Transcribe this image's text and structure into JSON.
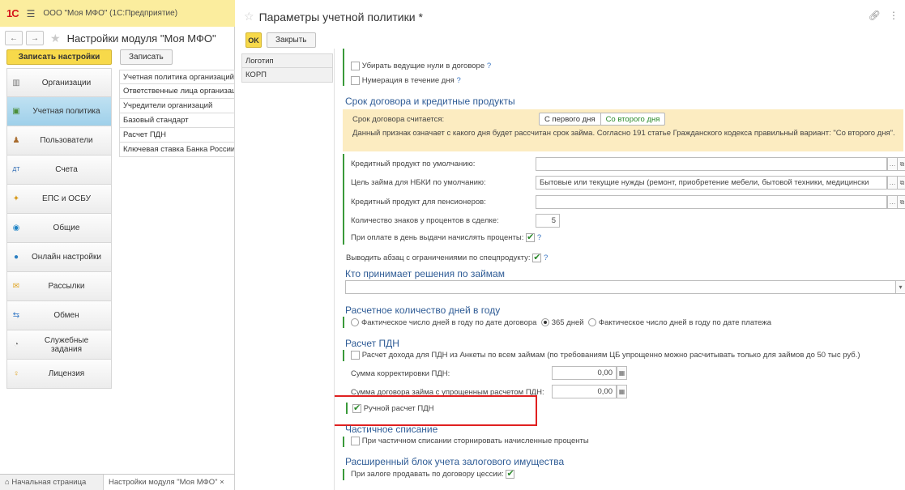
{
  "app": {
    "logo": "1С",
    "title": "ООО \"Моя МФО\"  (1С:Предприятие)"
  },
  "module": {
    "title": "Настройки модуля \"Моя МФО\"",
    "save_settings": "Записать настройки",
    "save": "Записать",
    "sections": [
      {
        "label": "Организации",
        "icon": "building-icon"
      },
      {
        "label": "Учетная политика",
        "icon": "policy-icon"
      },
      {
        "label": "Пользователи",
        "icon": "user-icon"
      },
      {
        "label": "Счета",
        "icon": "accounts-icon"
      },
      {
        "label": "ЕПС и ОСБУ",
        "icon": "eps-icon"
      },
      {
        "label": "Общие",
        "icon": "general-icon"
      },
      {
        "label": "Онлайн настройки",
        "icon": "online-icon"
      },
      {
        "label": "Рассылки",
        "icon": "mail-icon"
      },
      {
        "label": "Обмен",
        "icon": "exchange-icon"
      },
      {
        "label": "Служебные задания",
        "icon": "jobs-icon"
      },
      {
        "label": "Лицензия",
        "icon": "license-icon"
      }
    ],
    "subnav": [
      "Учетная политика организаций",
      "Ответственные лица организаций",
      "Учредители организаций",
      "Базовый стандарт",
      "Расчет ПДН",
      "Ключевая ставка Банка России"
    ],
    "bottom_tabs": [
      "Начальная страница",
      "Настройки модуля \"Моя МФО\""
    ],
    "tab_close": "×"
  },
  "form": {
    "title": "Параметры учетной политики *",
    "ok": "OK",
    "close": "Закрыть",
    "tabs": [
      "Логотип",
      "КОРП"
    ],
    "opt_remove_zeros": "Убирать ведущие нули в договоре",
    "opt_day_numbering": "Нумерация в течение дня",
    "help_mark": "?",
    "section_term": "Срок договора и кредитные продукты",
    "term_label": "Срок договора считается:",
    "term_first": "С первого дня",
    "term_second": "Со второго дня",
    "term_note": "Данный признак означает с какого дня будет рассчитан срок займа. Согласно 191 статье Гражданского кодекса правильный вариант: \"Со второго дня\".",
    "credit_product_label": "Кредитный продукт по умолчанию:",
    "credit_product_value": "",
    "nbki_label": "Цель займа для НБКИ по умолчанию:",
    "nbki_value": "Бытовые или текущие нужды (ремонт, приобретение мебели, бытовой техники, медицински",
    "pension_label": "Кредитный продукт для пенсионеров:",
    "pension_value": "",
    "decimals_label": "Количество знаков у процентов в сделке:",
    "decimals_value": "5",
    "accrue_label": "При оплате в день выдачи начислять проценты:",
    "paragraph_label": "Выводить абзац с ограничениями по спецпродукту:",
    "section_decisions": "Кто принимает решения по займам",
    "decisions_value": "",
    "section_days": "Расчетное количество дней в году",
    "days_opt1": "Фактическое число дней в году по дате договора",
    "days_opt2": "365 дней",
    "days_opt3": "Фактическое число дней в году по дате платежа",
    "section_pdn": "Расчет ПДН",
    "pdn_income": "Расчет дохода для ПДН из Анкеты по всем займам (по требованиям ЦБ упрощенно можно расчитывать только для займов до 50 тыс руб.)",
    "pdn_correction_label": "Сумма корректировки ПДН:",
    "pdn_correction_value": "0,00",
    "pdn_simplified_label": "Сумма договора займа с упрощенным расчетом ПДН:",
    "pdn_simplified_value": "0,00",
    "pdn_manual": "Ручной расчет ПДН",
    "section_partial": "Частичное списание",
    "partial_opt": "При частичном списании сторнировать начисленные проценты",
    "section_collateral": "Расширенный блок учета залогового имущества",
    "collateral_opt": "При залоге продавать по договору цессии:"
  }
}
